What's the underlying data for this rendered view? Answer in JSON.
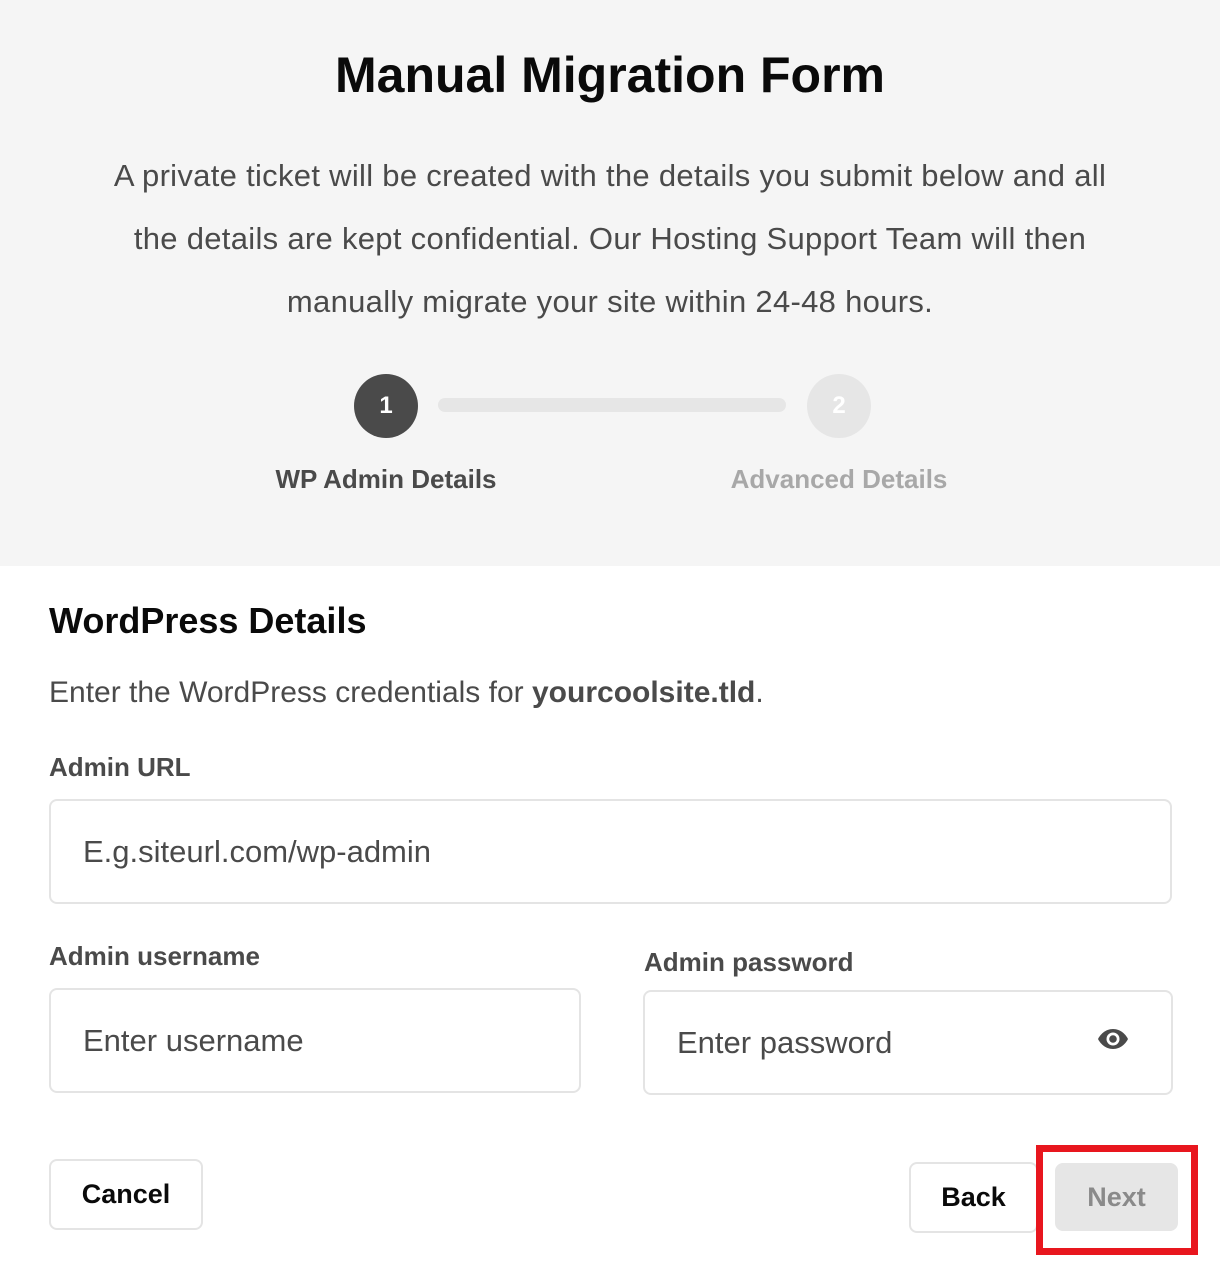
{
  "header": {
    "title": "Manual Migration Form",
    "description": "A private ticket will be created with the details you submit below and all the details are kept confidential. Our Hosting Support Team will then manually migrate your site within 24-48 hours."
  },
  "stepper": {
    "steps": [
      {
        "number": "1",
        "label": "WP Admin Details",
        "state": "active"
      },
      {
        "number": "2",
        "label": "Advanced Details",
        "state": "inactive"
      }
    ]
  },
  "section": {
    "title": "WordPress Details",
    "desc_prefix": "Enter the WordPress credentials for ",
    "desc_site": "yourcoolsite.tld",
    "desc_suffix": "."
  },
  "form": {
    "admin_url": {
      "label": "Admin URL",
      "placeholder": "E.g.siteurl.com/wp-admin",
      "value": ""
    },
    "admin_username": {
      "label": "Admin username",
      "placeholder": "Enter username",
      "value": ""
    },
    "admin_password": {
      "label": "Admin password",
      "placeholder": "Enter password",
      "value": "",
      "toggle_icon": "eye-icon"
    }
  },
  "buttons": {
    "cancel": "Cancel",
    "back": "Back",
    "next": "Next"
  },
  "colors": {
    "header_bg": "#f5f5f5",
    "active_step": "#4a4a4a",
    "inactive_step": "#e6e6e6",
    "highlight": "#e8161e"
  }
}
